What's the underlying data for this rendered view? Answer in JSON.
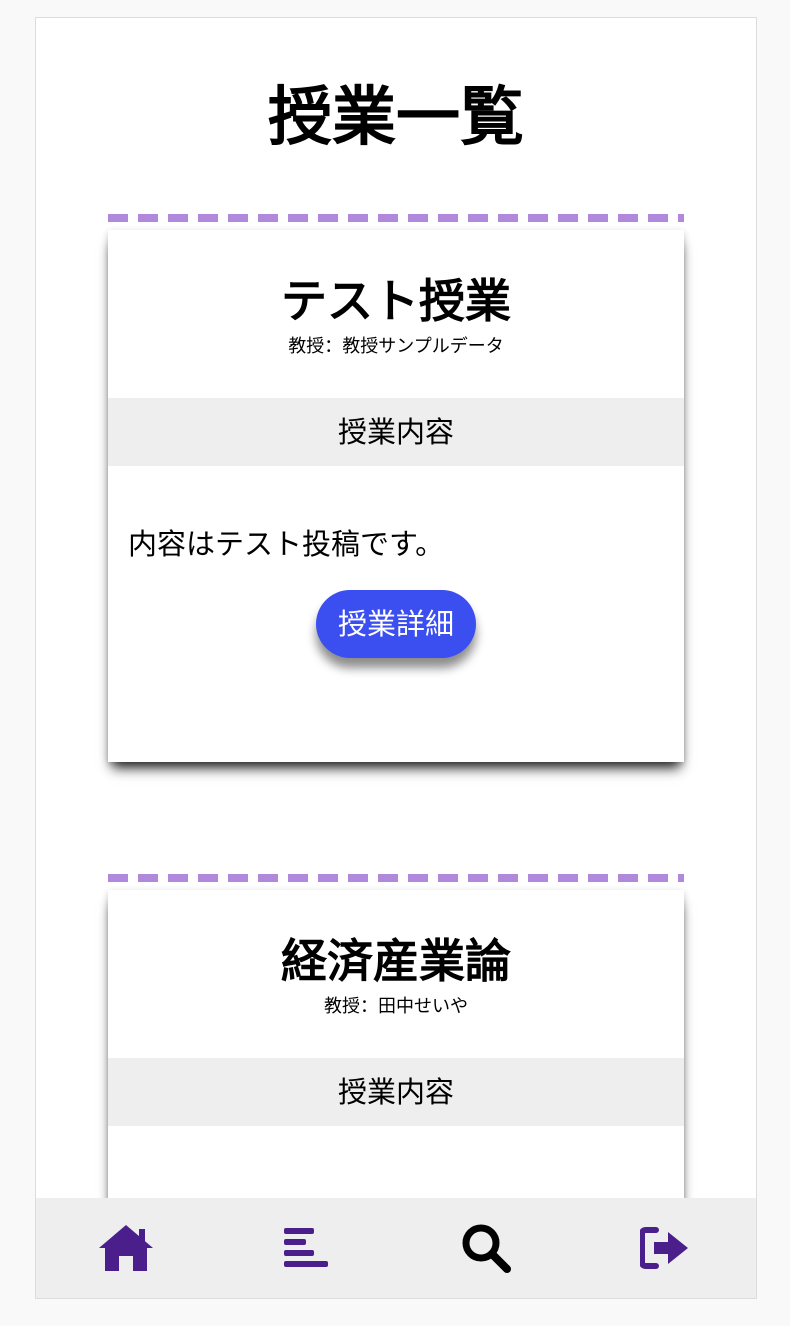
{
  "page": {
    "title": "授業一覧"
  },
  "courses": [
    {
      "name": "テスト授業",
      "professor": "教授：教授サンプルデータ",
      "content_header": "授業内容",
      "content": "内容はテスト投稿です。",
      "detail_button": "授業詳細"
    },
    {
      "name": "経済産業論",
      "professor": "教授：田中せいや",
      "content_header": "授業内容",
      "content": "",
      "detail_button": ""
    }
  ],
  "bottom_nav": {
    "items": [
      {
        "icon": "home-icon",
        "color": "#4a1f8c"
      },
      {
        "icon": "list-icon",
        "color": "#4a1f8c"
      },
      {
        "icon": "search-icon",
        "color": "#000000"
      },
      {
        "icon": "logout-icon",
        "color": "#4a1f8c"
      }
    ]
  },
  "colors": {
    "accent_dash": "#b089dd",
    "button": "#3b4ef0",
    "nav_icon": "#4a1f8c",
    "header_bg": "#eeeeee"
  }
}
